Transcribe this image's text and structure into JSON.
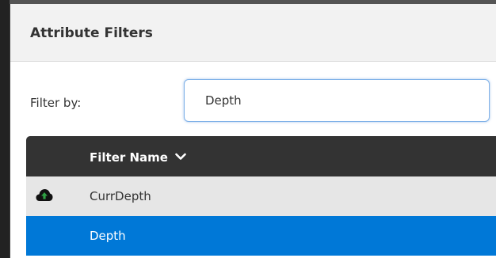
{
  "panel": {
    "title": "Attribute Filters"
  },
  "filter": {
    "label": "Filter by:",
    "value": "Depth"
  },
  "table": {
    "column_header": "Filter Name",
    "sort_icon": "chevron-down-icon",
    "rows": [
      {
        "name": "CurrDepth",
        "icon": "cloud-upload-icon",
        "selected": false
      },
      {
        "name": "Depth",
        "icon": "",
        "selected": true
      }
    ]
  },
  "colors": {
    "header_dark": "#333333",
    "row_background": "#e6e6e6",
    "selected_row": "#0078d7",
    "upload_arrow": "#2ea043"
  }
}
